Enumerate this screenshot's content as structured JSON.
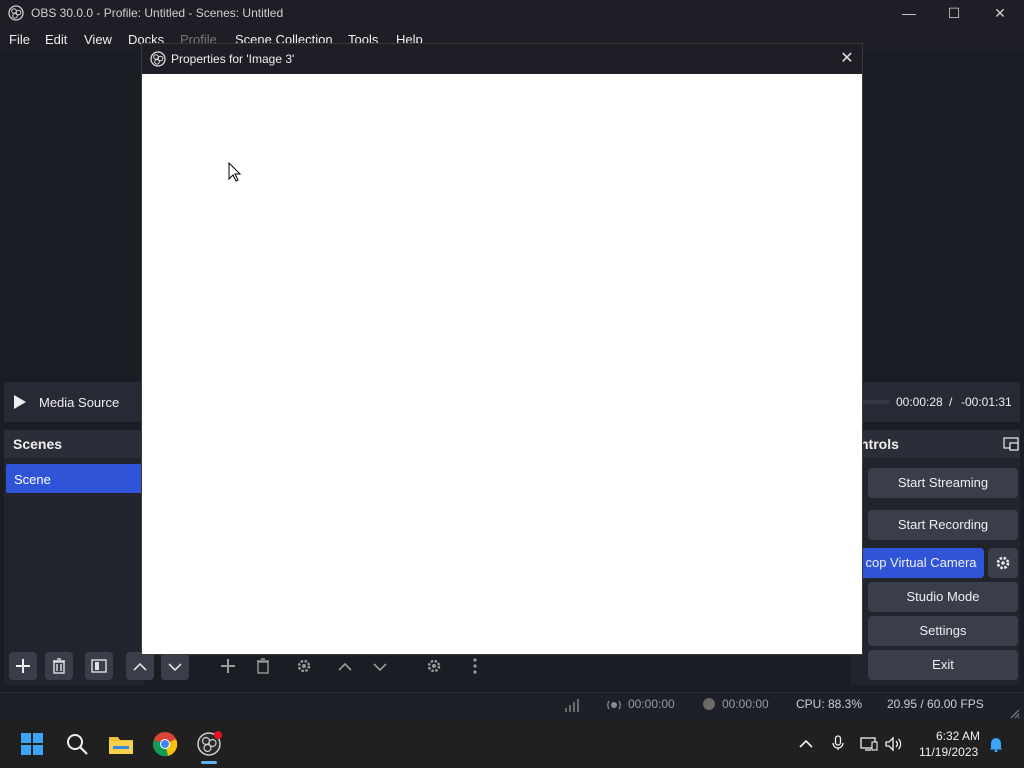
{
  "window": {
    "title": "OBS 30.0.0 - Profile: Untitled - Scenes: Untitled",
    "minimize": "—",
    "maximize": "☐",
    "close": "✕"
  },
  "menu": [
    "File",
    "Edit",
    "View",
    "Docks",
    "Profile",
    "Scene Collection",
    "Tools",
    "Help"
  ],
  "media": {
    "source_name": "Media Source",
    "time_current": "00:00:28",
    "time_separator": "/",
    "time_remaining": "-00:01:31"
  },
  "scenes": {
    "header": "Scenes",
    "items": [
      "Scene"
    ]
  },
  "controls": {
    "header": "ntrols",
    "buttons": [
      "Start Streaming",
      "Start Recording",
      "cop Virtual Camera",
      "Studio Mode",
      "Settings",
      "Exit"
    ]
  },
  "status": {
    "stream_time": "00:00:00",
    "record_time": "00:00:00",
    "cpu": "CPU: 88.3%",
    "fps": "20.95 / 60.00 FPS"
  },
  "dialog": {
    "title": "Properties for 'Image 3'",
    "close": "✕"
  },
  "taskbar": {
    "time": "6:32 AM",
    "date": "11/19/2023"
  },
  "colors": {
    "accent": "#2f54d7",
    "background": "#1b1d24",
    "panel": "#21232d"
  }
}
